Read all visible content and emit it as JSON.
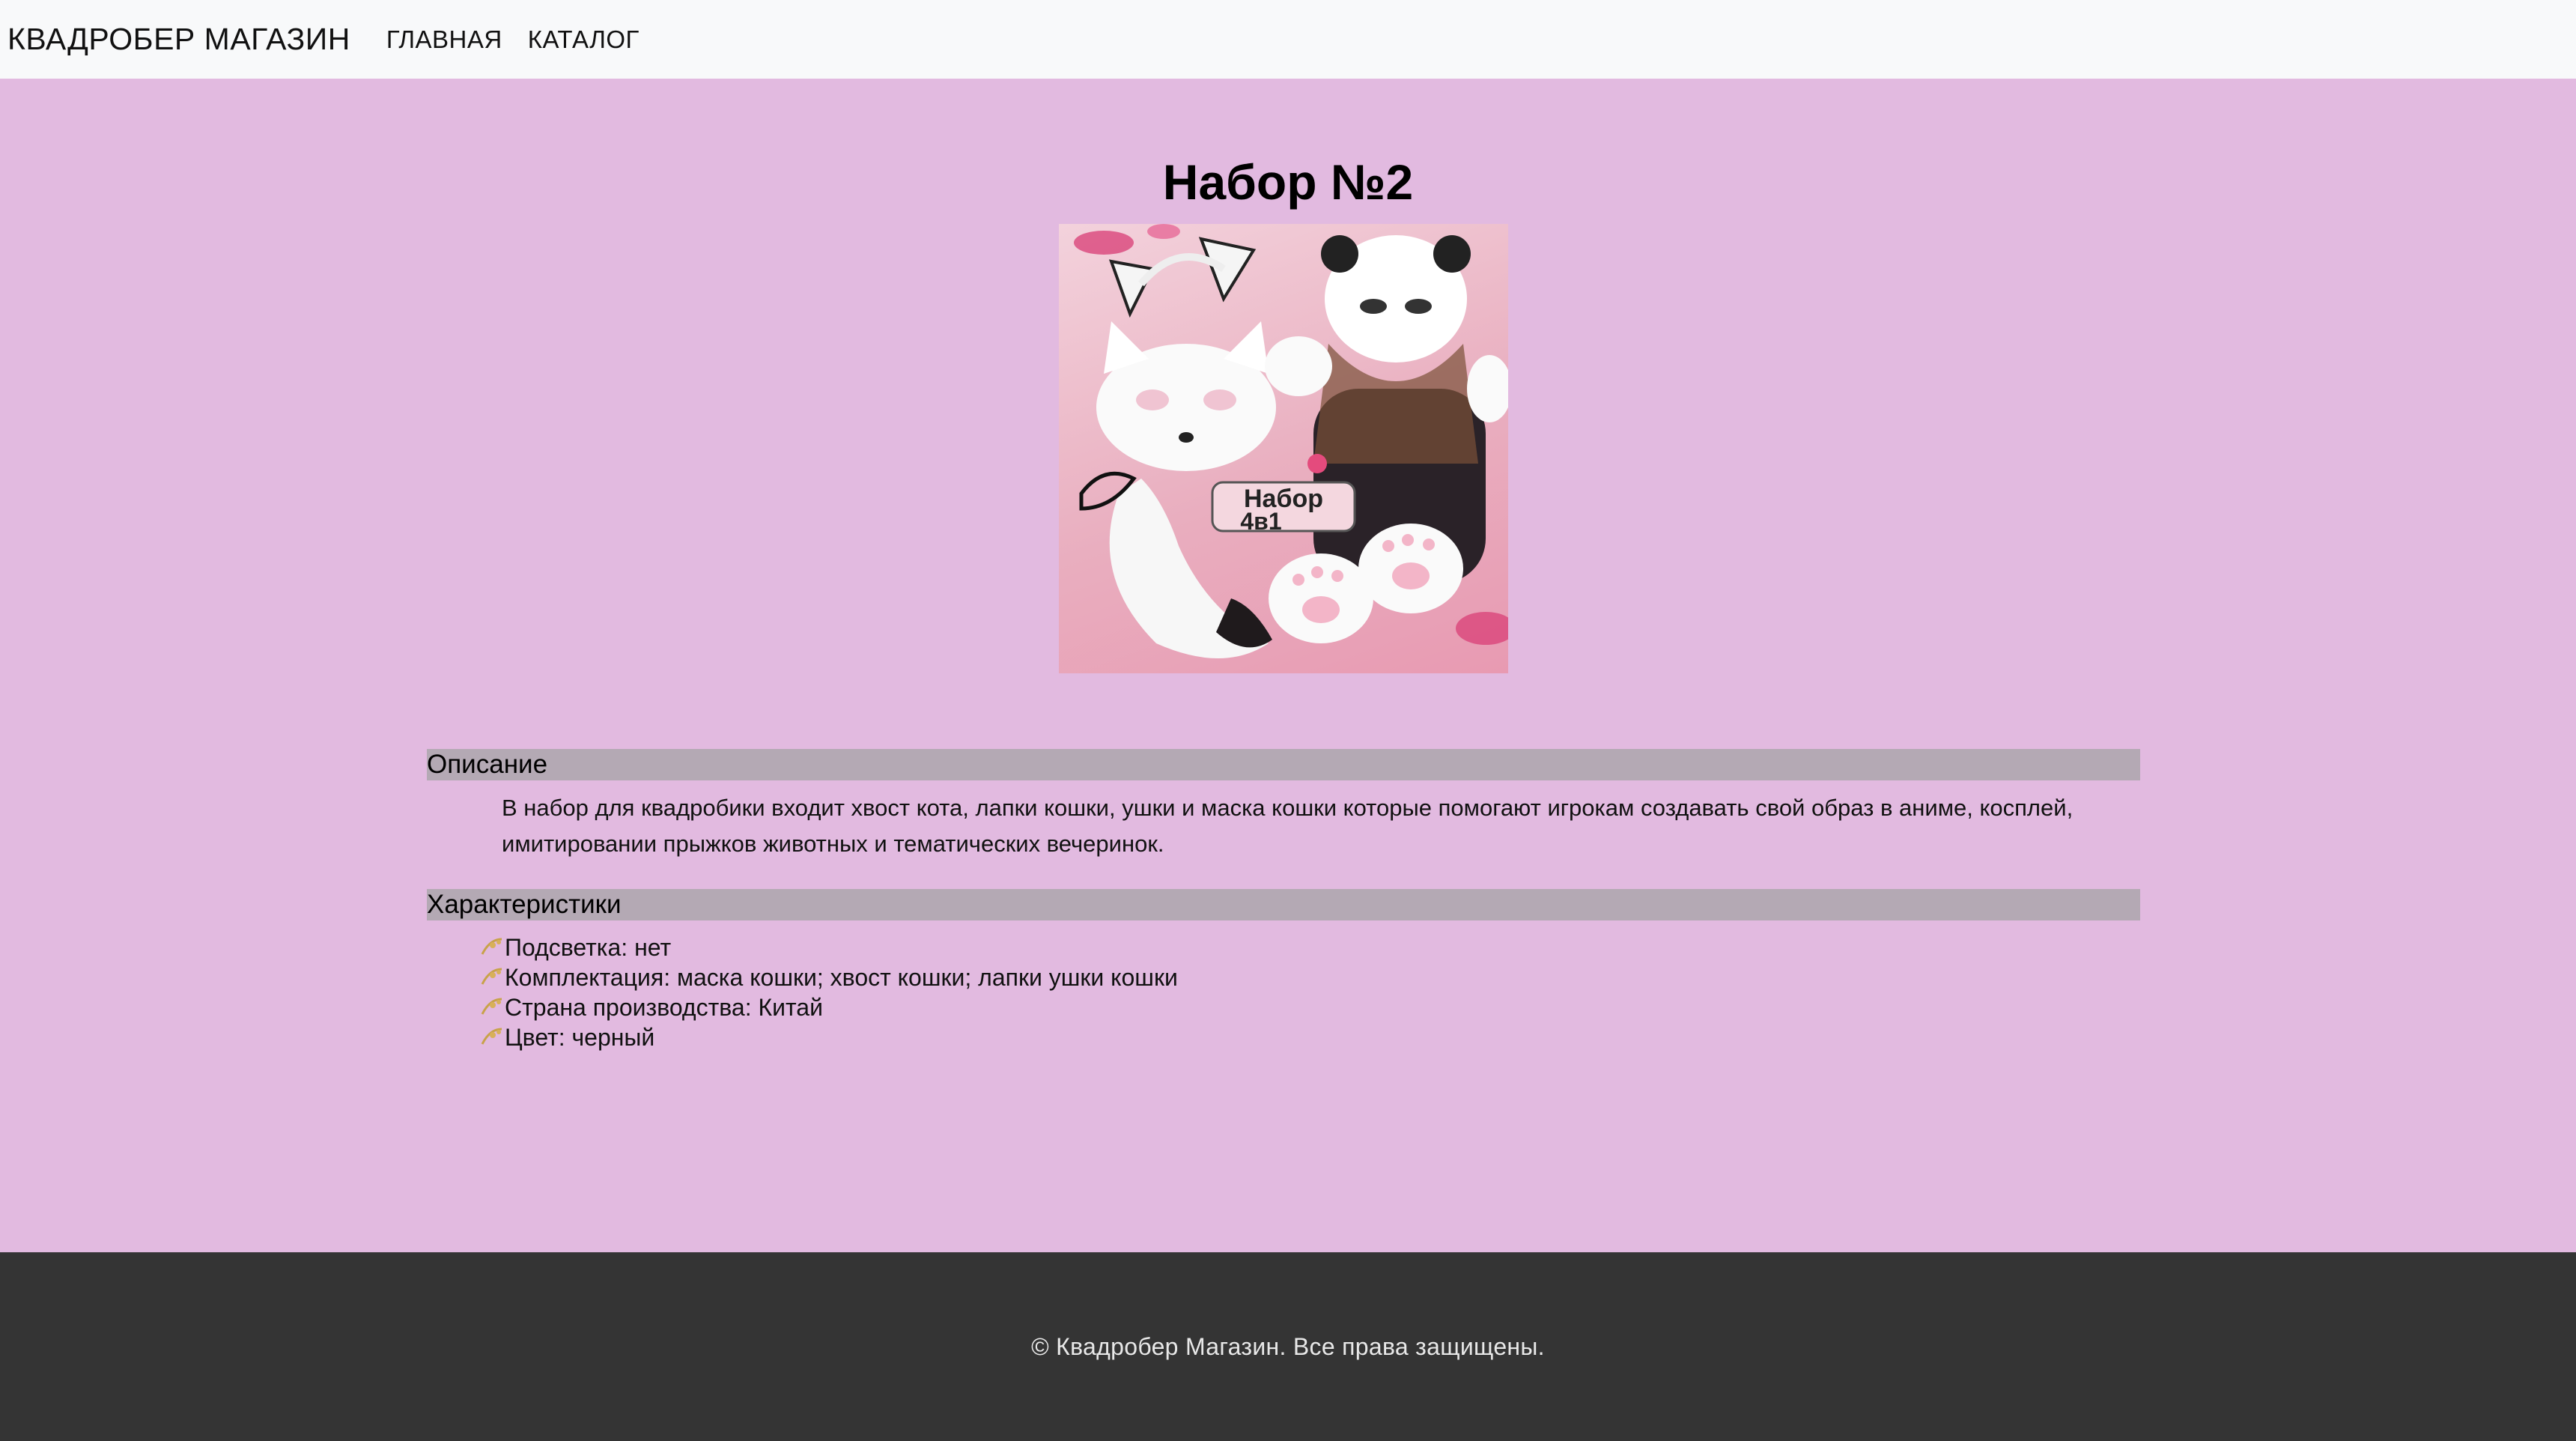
{
  "navbar": {
    "brand": "КВАДРОБЕР МАГАЗИН",
    "links": [
      "ГЛАВНАЯ",
      "КАТАЛОГ"
    ]
  },
  "product": {
    "title": "Набор №2",
    "image_badge": {
      "line1": "Набор",
      "line2": "4в1"
    },
    "description_header": "Описание",
    "description": "В набор для квадробики входит хвост кота, лапки кошки, ушки и маска кошки которые помогают игрокам создавать свой образ в аниме, косплей, имитировании прыжков животных и тематических вечеринок.",
    "characteristics_header": "Характеристики",
    "characteristics": [
      "Подсветка: нет",
      "Комплектация: маска кошки; хвост кошки; лапки ушки кошки",
      "Страна производства: Китай",
      "Цвет: черный"
    ]
  },
  "footer": {
    "text": "© Квадробер Магазин. Все права защищены."
  },
  "colors": {
    "page_bg": "#e2bae0",
    "navbar_bg": "#f8f9fa",
    "section_header_bg": "#b4a9b4",
    "footer_bg": "#343434"
  }
}
